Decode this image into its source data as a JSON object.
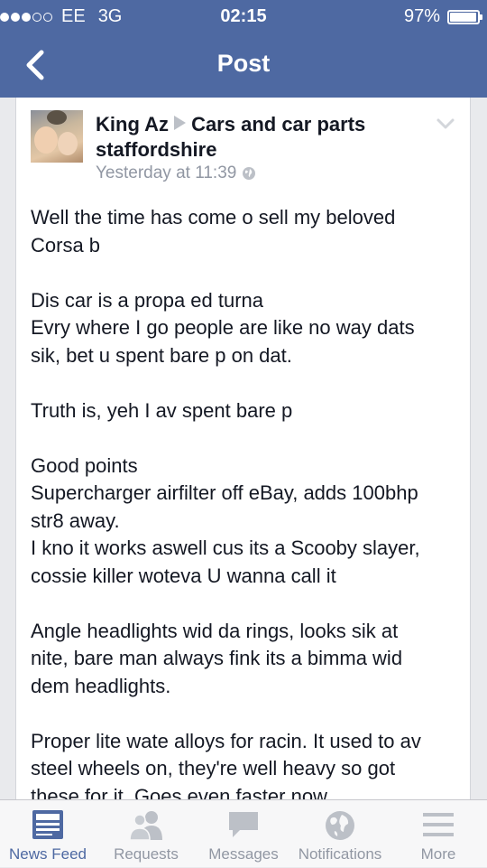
{
  "status_bar": {
    "carrier": "EE",
    "network": "3G",
    "time": "02:15",
    "battery_text": "97%",
    "battery_level": 0.97,
    "signal_bars_filled": 3,
    "signal_bars_total": 5
  },
  "nav": {
    "title": "Post",
    "back_icon": "chevron-left-icon"
  },
  "post": {
    "author": "King Az",
    "group": "Cars and car parts staffordshire",
    "timestamp": "Yesterday at 11:39",
    "privacy_icon": "globe-icon",
    "menu_icon": "chevron-down-icon",
    "paragraphs": [
      "Well the time has come o sell my beloved\nCorsa b",
      "Dis car is a propa ed turna\nEvry where I go people are like no way dats\nsik, bet u spent bare p on dat.",
      "Truth is, yeh I av spent bare p",
      "Good points\nSupercharger airfilter off eBay, adds 100bhp\nstr8 away.\nI kno it works aswell cus its a Scooby slayer,\ncossie killer woteva U wanna call it",
      "Angle headlights wid da rings, looks sik at\nnite, bare man always fink its a bimma wid\ndem headlights.",
      "Proper lite wate alloys for racin. It used to av\nsteel wheels on, they're well heavy so got\nthese for it. Goes even faster now."
    ]
  },
  "tab_bar": {
    "tabs": [
      {
        "label": "News Feed",
        "icon": "news-feed-icon",
        "active": true
      },
      {
        "label": "Requests",
        "icon": "friend-requests-icon",
        "active": false
      },
      {
        "label": "Messages",
        "icon": "messages-icon",
        "active": false
      },
      {
        "label": "Notifications",
        "icon": "globe-icon",
        "active": false
      },
      {
        "label": "More",
        "icon": "menu-icon",
        "active": false
      }
    ]
  },
  "colors": {
    "brand_blue": "#4e69a2",
    "inactive_gray": "#9197a3"
  }
}
